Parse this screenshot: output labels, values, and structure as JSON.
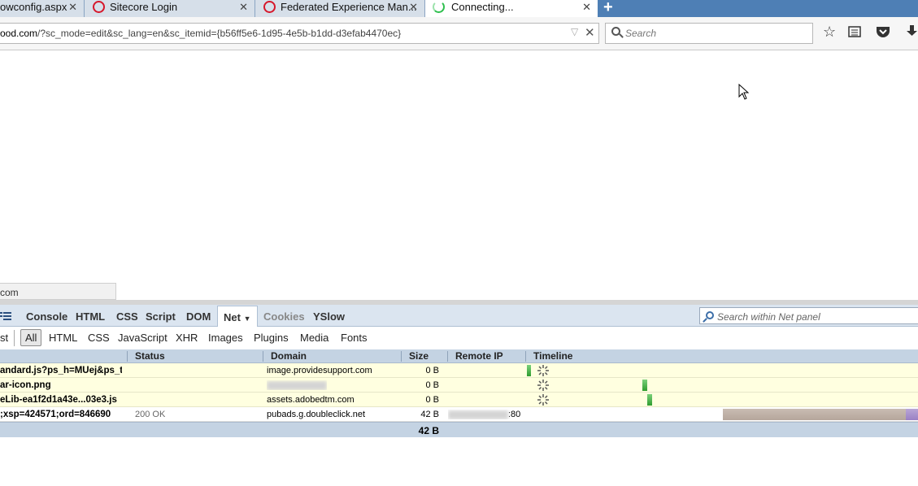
{
  "tabs": [
    {
      "label": "owconfig.aspx",
      "icon": "none"
    },
    {
      "label": "Sitecore Login",
      "icon": "opera-icon"
    },
    {
      "label": "Federated Experience Man...",
      "icon": "opera-icon"
    },
    {
      "label": "Connecting...",
      "icon": "loading-spinner-icon",
      "active": true
    }
  ],
  "navbar": {
    "url_prefix": "ood.com",
    "url_rest": "/?sc_mode=edit&sc_lang=en&sc_itemid={b56ff5e6-1d95-4e5b-b1dd-d3efab4470ec}",
    "search_placeholder": "Search"
  },
  "status_panel": "com",
  "firebug": {
    "tabs": [
      "Console",
      "HTML",
      "CSS",
      "Script",
      "DOM",
      "Net",
      "Cookies",
      "YSlow"
    ],
    "selected_tab": "Net",
    "search_placeholder": "Search within Net panel",
    "filters": [
      "st",
      "All",
      "HTML",
      "CSS",
      "JavaScript",
      "XHR",
      "Images",
      "Plugins",
      "Media",
      "Fonts"
    ],
    "selected_filter": "All",
    "columns": {
      "status": "Status",
      "domain": "Domain",
      "size": "Size",
      "remote_ip": "Remote IP",
      "timeline": "Timeline"
    },
    "rows": [
      {
        "url": "andard.js?ps_h=MUej&ps_t",
        "status": "",
        "domain": "image.providesupport.com",
        "size": "0 B",
        "remote_ip": ""
      },
      {
        "url": "ar-icon.png",
        "status": "",
        "domain": "",
        "size": "0 B",
        "remote_ip": ""
      },
      {
        "url": "eLib-ea1f2d1a43e...03e3.js",
        "status": "",
        "domain": "assets.adobedtm.com",
        "size": "0 B",
        "remote_ip": ""
      },
      {
        "url": ";xsp=424571;ord=846690",
        "status": "200 OK",
        "domain": "pubads.g.doubleclick.net",
        "size": "42 B",
        "remote_ip": ":80"
      }
    ],
    "total_size": "42 B"
  }
}
